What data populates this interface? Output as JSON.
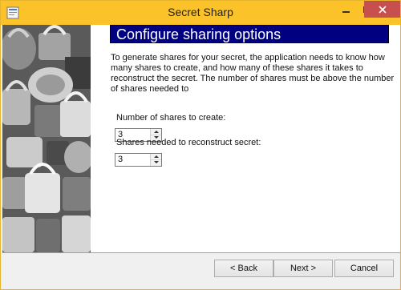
{
  "window": {
    "title": "Secret Sharp"
  },
  "header": {
    "title": "Configure sharing options"
  },
  "description": "To generate shares for your secret, the application needs to know how many shares to create, and how many of these shares it takes to reconstruct the secret. The number of shares must be above the number of shares needed to",
  "fields": {
    "shares_to_create": {
      "label": "Number of shares to create:",
      "value": "3"
    },
    "shares_needed": {
      "label": "Shares needed to reconstruct secret:",
      "value": "3"
    }
  },
  "buttons": {
    "back": "< Back",
    "next": "Next >",
    "cancel": "Cancel"
  },
  "colors": {
    "titlebar": "#fbc229",
    "close": "#c74f4d",
    "banner": "#000080"
  }
}
